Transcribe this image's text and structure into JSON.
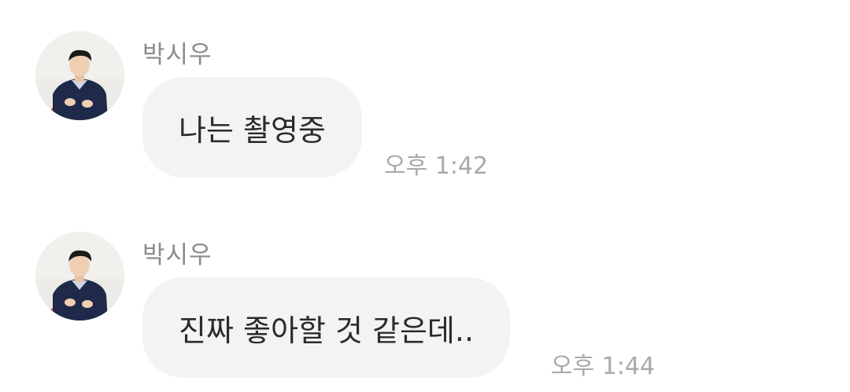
{
  "messages": [
    {
      "sender": "박시우",
      "text": "나는 촬영중",
      "time": "오후 1:42"
    },
    {
      "sender": "박시우",
      "text": "진짜 좋아할 것 같은데..",
      "time": "오후 1:44"
    }
  ],
  "colors": {
    "bubble": "#f3f3f6",
    "sender": "#8a8a8f",
    "time": "#a8a8ad",
    "text": "#2b2b2e"
  }
}
